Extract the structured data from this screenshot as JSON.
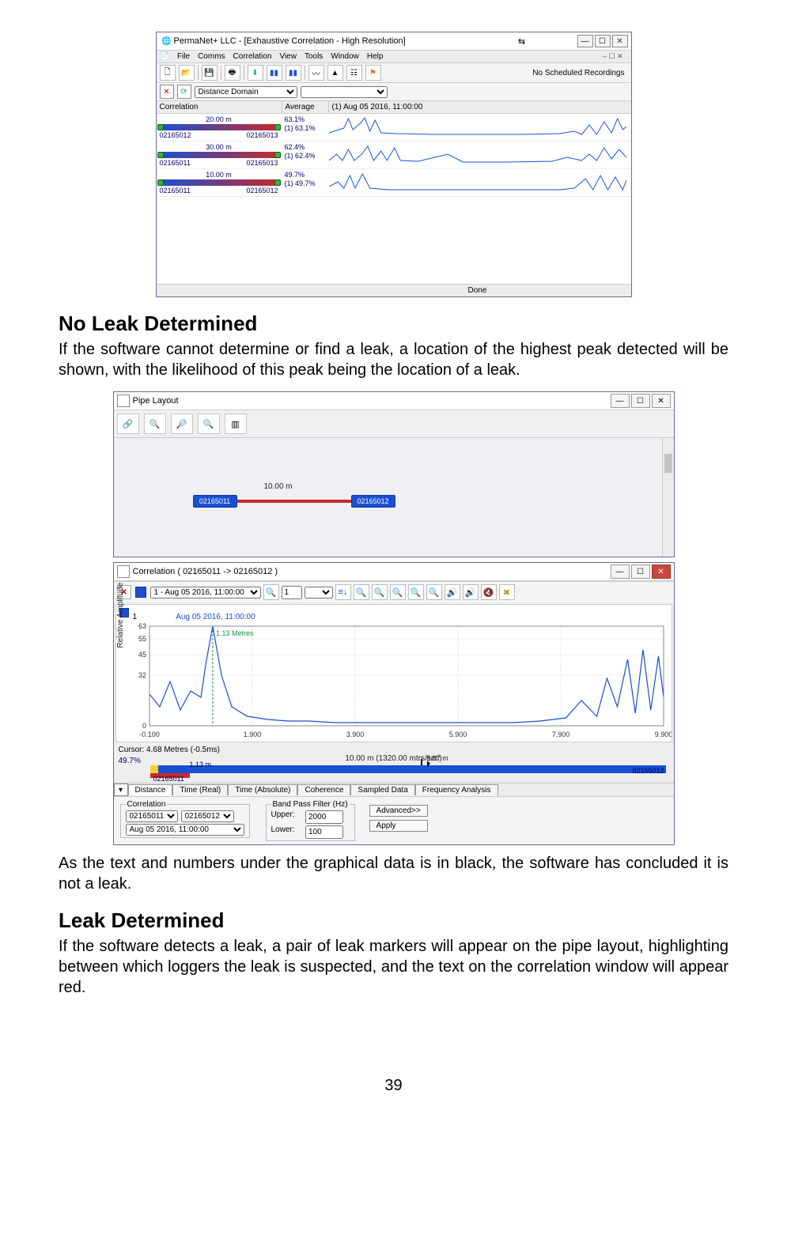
{
  "page_number": "39",
  "headings": {
    "no_leak": "No Leak Determined",
    "leak": "Leak Determined"
  },
  "paragraphs": {
    "no_leak_intro": "If the software cannot determine or find a leak, a location of the highest peak detected will be shown, with the likelihood of this peak being the location of a leak.",
    "no_leak_conc": "As the text and numbers under the graphical data is in black, the software has concluded it is not a leak.",
    "leak_intro": "If the software detects a leak, a pair of leak markers will appear on the pipe layout, highlighting between which loggers the leak is suspected, and the text on the correlation window will appear red."
  },
  "shot1": {
    "app_title": "PermaNet+ LLC - [Exhaustive Correlation - High Resolution]",
    "menus": [
      "File",
      "Comms",
      "Correlation",
      "View",
      "Tools",
      "Window",
      "Help"
    ],
    "toolbar_right": "No Scheduled Recordings",
    "domain_select": "Distance Domain",
    "cols": {
      "correlation": "Correlation",
      "average": "Average",
      "date": "(1) Aug 05 2016, 11:00:00"
    },
    "rows": [
      {
        "dist": "20.00 m",
        "lgA": "02165012",
        "lgB": "02165013",
        "avg": "63.1%",
        "sub": "(1) 63.1%"
      },
      {
        "dist": "30.00 m",
        "lgA": "02165011",
        "lgB": "02165013",
        "avg": "62.4%",
        "sub": "(1) 62.4%"
      },
      {
        "dist": "10.00 m",
        "lgA": "02165011",
        "lgB": "02165012",
        "avg": "49.7%",
        "sub": "(1) 49.7%"
      }
    ],
    "status": "Done"
  },
  "shot2": {
    "pipe_title": "Pipe Layout",
    "pipe_length": "10.00 m",
    "loggerA": "02165011",
    "loggerB": "02165012",
    "corr_title": "Correlation ( 02165011 -> 02165012 )",
    "series_label": "1 - Aug 05 2016, 11:00:00",
    "index_field": "1",
    "chart_title": "Aug 05 2016, 11:00:00",
    "annotation": "1.13 Metres",
    "ylabel": "Relative Amplitude",
    "cursor": "Cursor: 4.68 Metres (-0.5ms)",
    "pct": "49.7%",
    "ruler_label": "10.00 m  (1320.00 mtrs/sec)",
    "endA": "02165011",
    "endA_marker": "1.13 m",
    "midpt": "8.87 m",
    "endB": "02165012",
    "tabs": [
      "Distance",
      "Time (Real)",
      "Time (Absolute)",
      "Coherence",
      "Sampled Data",
      "Frequency Analysis"
    ],
    "corr_group": "Correlation",
    "corr_selA": "02165011",
    "corr_selB": "02165012",
    "corr_date": "Aug 05 2016, 11:00:00",
    "bpf_group": "Band Pass Filter (Hz)",
    "upper_lbl": "Upper:",
    "upper_val": "2000",
    "lower_lbl": "Lower:",
    "lower_val": "100",
    "adv_btn": "Advanced>>",
    "apply_btn": "Apply"
  },
  "chart_data": {
    "type": "line",
    "title": "Aug 05 2016, 11:00:00",
    "xlabel": "",
    "ylabel": "Relative Amplitude",
    "xlim": [
      -0.1,
      9.9
    ],
    "ylim": [
      0,
      63
    ],
    "y_ticks": [
      0,
      32,
      45,
      55,
      63
    ],
    "x_ticks": [
      -0.1,
      1.9,
      3.9,
      5.9,
      7.9,
      9.9
    ],
    "annotations": [
      {
        "text": "1.13 Metres",
        "x": 1.13,
        "y": 63
      }
    ],
    "series": [
      {
        "name": "1",
        "color": "#1a4fd1",
        "x": [
          -0.1,
          0.1,
          0.3,
          0.5,
          0.7,
          0.9,
          1.0,
          1.13,
          1.3,
          1.5,
          1.8,
          2.2,
          2.6,
          3.0,
          3.5,
          4.0,
          4.5,
          5.0,
          5.5,
          6.0,
          6.5,
          7.0,
          7.5,
          8.0,
          8.3,
          8.6,
          8.8,
          9.0,
          9.2,
          9.35,
          9.5,
          9.65,
          9.8,
          9.9
        ],
        "values": [
          20,
          12,
          28,
          10,
          22,
          18,
          40,
          63,
          32,
          12,
          6,
          4,
          3,
          3,
          2,
          2,
          2,
          2,
          2,
          2,
          2,
          2,
          3,
          5,
          16,
          6,
          30,
          12,
          42,
          8,
          48,
          10,
          44,
          18
        ]
      }
    ]
  }
}
